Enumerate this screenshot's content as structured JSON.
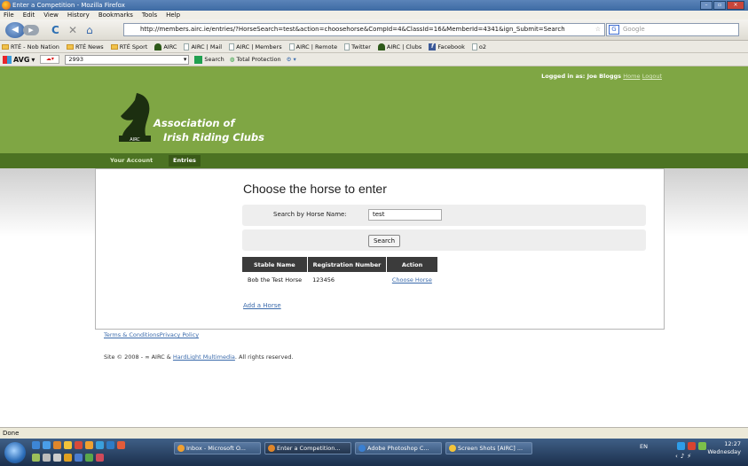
{
  "window": {
    "title": "Enter a Competition - Mozilla Firefox"
  },
  "menu": [
    "File",
    "Edit",
    "View",
    "History",
    "Bookmarks",
    "Tools",
    "Help"
  ],
  "nav": {
    "url": "http://members.airc.ie/entries/?HorseSearch=test&action=choosehorse&CompId=4&ClassId=16&MemberId=4341&ign_Submit=Search",
    "search_placeholder": "Google"
  },
  "bookmarks": [
    {
      "label": "RTÉ - Nob Nation",
      "icon": "folder-icon"
    },
    {
      "label": "RTÉ News",
      "icon": "folder-icon"
    },
    {
      "label": "RTÉ Sport",
      "icon": "folder-icon"
    },
    {
      "label": "AIRC",
      "icon": "horse-icon"
    },
    {
      "label": "AIRC | Mail",
      "icon": "page-icon"
    },
    {
      "label": "AIRC | Members",
      "icon": "page-icon"
    },
    {
      "label": "AIRC | Remote",
      "icon": "page-icon"
    },
    {
      "label": "Twitter",
      "icon": "page-icon"
    },
    {
      "label": "AIRC | Clubs",
      "icon": "horse-icon"
    },
    {
      "label": "Facebook",
      "icon": "facebook-icon"
    },
    {
      "label": "o2",
      "icon": "page-icon"
    }
  ],
  "avg": {
    "logo": "AVG",
    "temp": "2993",
    "search": "Search",
    "protection": "Total Protection"
  },
  "site": {
    "logged_in": "Logged in as: Joe Bloggs",
    "home": "Home",
    "logout": "Logout",
    "logo_line1": "Association of",
    "logo_line2": "Irish Riding Clubs",
    "logo_badge": "AIRC",
    "nav_account": "Your Account",
    "nav_entries": "Entries"
  },
  "main": {
    "heading": "Choose the horse to enter",
    "search_label": "Search by Horse Name:",
    "search_value": "test",
    "search_button": "Search",
    "table": {
      "headers": [
        "Stable Name",
        "Registration Number",
        "Action"
      ],
      "rows": [
        [
          "Bob the Test Horse",
          "123456",
          "Choose Horse"
        ]
      ]
    },
    "add_horse": "Add a Horse"
  },
  "footer": {
    "terms": "Terms & ConditionsPrivacy Policy",
    "copy_prefix": "Site © 2008 - ∞ AIRC & ",
    "copy_link": "HardLight Multimedia",
    "copy_suffix": ". All rights reserved."
  },
  "status": "Done",
  "taskbar": {
    "tasks": [
      "Inbox - Microsoft O...",
      "Enter a Competition...",
      "Adobe Photoshop C...",
      "Screen Shots [AIRC] ..."
    ],
    "lang": "EN",
    "time": "12:27",
    "day": "Wednesday"
  },
  "colors": {
    "header_green": "#7fa644",
    "nav_green": "#4c7323",
    "link_blue": "#3a6aab"
  }
}
